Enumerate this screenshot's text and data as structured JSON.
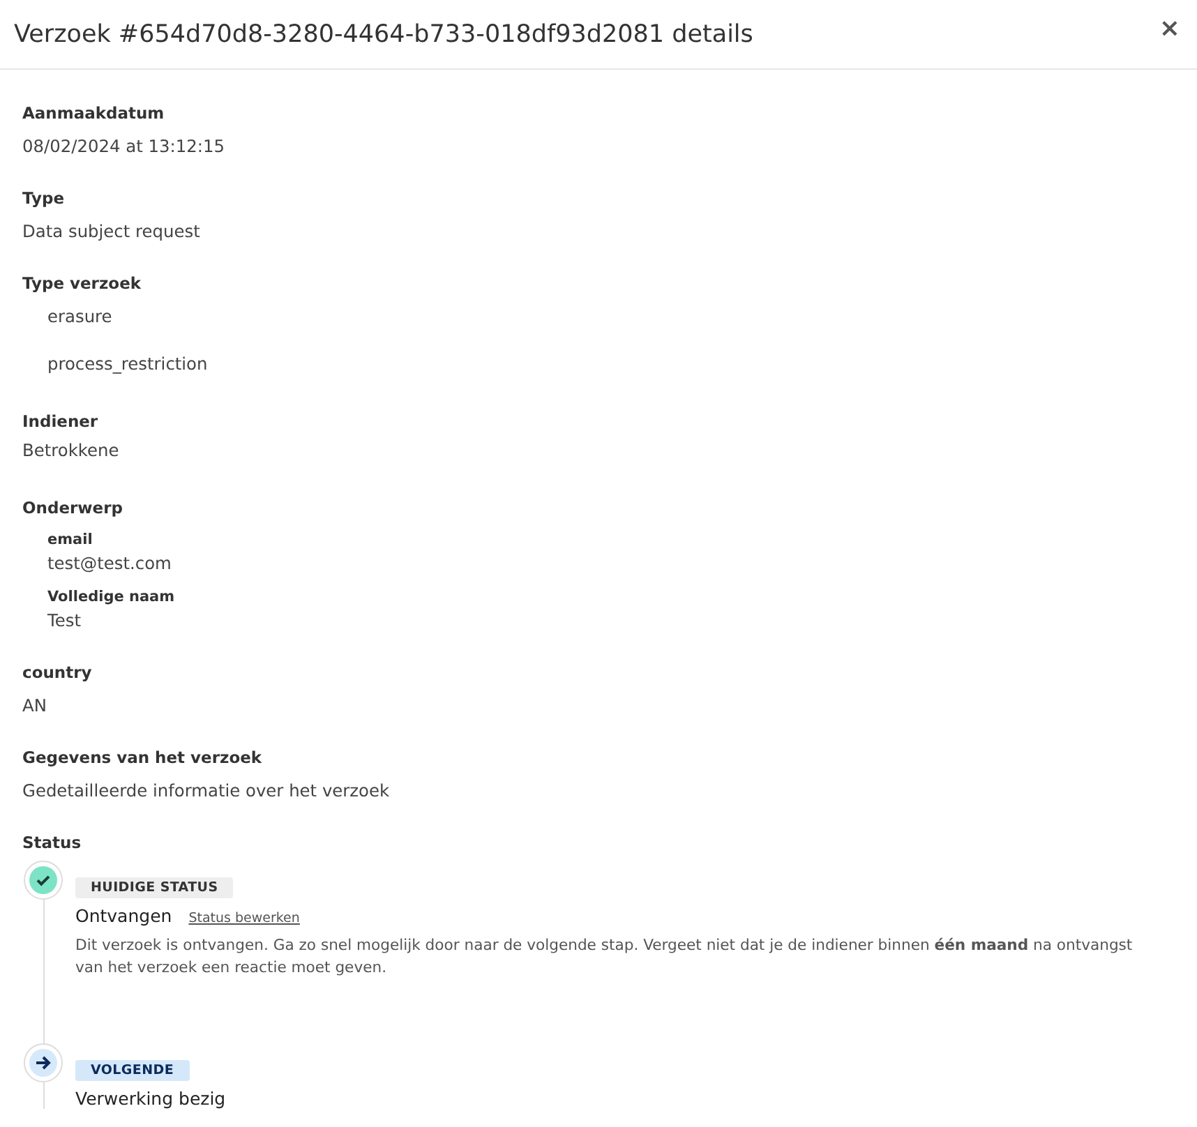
{
  "dialog": {
    "title": "Verzoek #654d70d8-3280-4464-b733-018df93d2081 details",
    "close": "×"
  },
  "sections": [
    {
      "kind": "text",
      "label": "Aanmaakdatum",
      "value": "08/02/2024 at 13:12:15"
    },
    {
      "kind": "text",
      "label": "Type",
      "value": "Data subject request"
    },
    {
      "kind": "list",
      "label": "Type verzoek",
      "items": [
        "erasure",
        "process_restriction"
      ]
    },
    {
      "kind": "tight",
      "label": "Indiener",
      "value": "Betrokkene"
    },
    {
      "kind": "fields",
      "label": "Onderwerp",
      "fields": [
        {
          "label": "email",
          "value": "test@test.com"
        },
        {
          "label": "Volledige naam",
          "value": "Test"
        }
      ]
    },
    {
      "kind": "text",
      "label": "country",
      "value": "AN"
    },
    {
      "kind": "text",
      "label": "Gegevens van het verzoek",
      "value": "Gedetailleerde informatie over het verzoek"
    }
  ],
  "status": {
    "label": "Status",
    "steps": [
      {
        "kind": "current",
        "badge": "HUIDIGE STATUS",
        "name": "Ontvangen",
        "link": "Status bewerken",
        "description": "Dit verzoek is ontvangen. Ga zo snel mogelijk door naar de volgende stap. Vergeet niet dat je de indiener binnen **één maand** na ontvangst van het verzoek een reactie moet geven."
      },
      {
        "kind": "next",
        "badge": "VOLGENDE",
        "name": "Verwerking bezig"
      }
    ]
  }
}
